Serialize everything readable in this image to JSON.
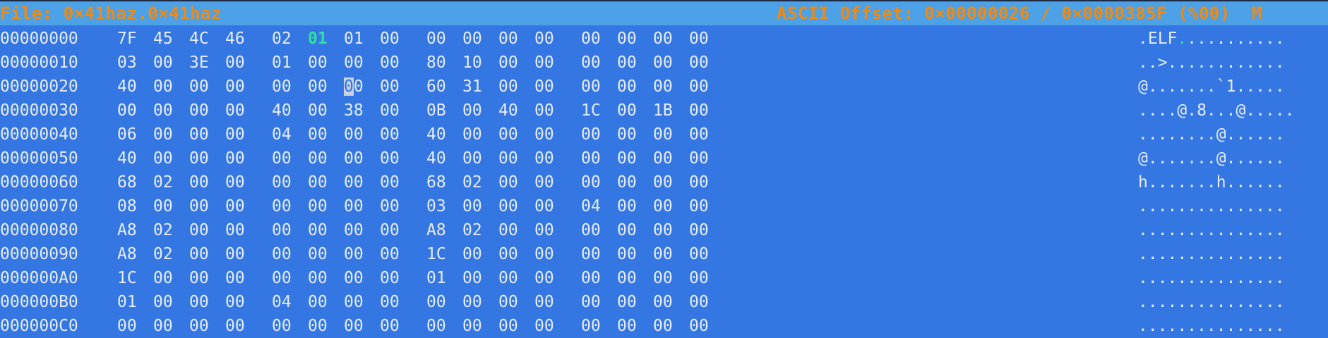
{
  "status": {
    "file_title": "File: 0×41haz.0×41haz",
    "offset_info": "ASCII Offset: 0×00000026 / 0×0000385F (%00)  M"
  },
  "colors": {
    "background": "#3477e3",
    "status_bar": "#4da1e6",
    "status_text": "#f08a10",
    "hex_text": "#e6ecf6",
    "highlight": "#2ee0a0"
  },
  "rows": [
    {
      "offset": "00000000",
      "bytes": [
        "7F",
        "45",
        "4C",
        "46",
        "02",
        "01",
        "01",
        "00",
        "00",
        "00",
        "00",
        "00",
        "00",
        "00",
        "00",
        "00"
      ],
      "ascii": ".ELF..........."
    },
    {
      "offset": "00000010",
      "bytes": [
        "03",
        "00",
        "3E",
        "00",
        "01",
        "00",
        "00",
        "00",
        "80",
        "10",
        "00",
        "00",
        "00",
        "00",
        "00",
        "00"
      ],
      "ascii": "..>............"
    },
    {
      "offset": "00000020",
      "bytes": [
        "40",
        "00",
        "00",
        "00",
        "00",
        "00",
        "00",
        "00",
        "60",
        "31",
        "00",
        "00",
        "00",
        "00",
        "00",
        "00"
      ],
      "ascii": "@.......`1....."
    },
    {
      "offset": "00000030",
      "bytes": [
        "00",
        "00",
        "00",
        "00",
        "40",
        "00",
        "38",
        "00",
        "0B",
        "00",
        "40",
        "00",
        "1C",
        "00",
        "1B",
        "00"
      ],
      "ascii": "....@.8...@....."
    },
    {
      "offset": "00000040",
      "bytes": [
        "06",
        "00",
        "00",
        "00",
        "04",
        "00",
        "00",
        "00",
        "40",
        "00",
        "00",
        "00",
        "00",
        "00",
        "00",
        "00"
      ],
      "ascii": "........@......"
    },
    {
      "offset": "00000050",
      "bytes": [
        "40",
        "00",
        "00",
        "00",
        "00",
        "00",
        "00",
        "00",
        "40",
        "00",
        "00",
        "00",
        "00",
        "00",
        "00",
        "00"
      ],
      "ascii": "@.......@......"
    },
    {
      "offset": "00000060",
      "bytes": [
        "68",
        "02",
        "00",
        "00",
        "00",
        "00",
        "00",
        "00",
        "68",
        "02",
        "00",
        "00",
        "00",
        "00",
        "00",
        "00"
      ],
      "ascii": "h.......h......"
    },
    {
      "offset": "00000070",
      "bytes": [
        "08",
        "00",
        "00",
        "00",
        "00",
        "00",
        "00",
        "00",
        "03",
        "00",
        "00",
        "00",
        "04",
        "00",
        "00",
        "00"
      ],
      "ascii": "..............."
    },
    {
      "offset": "00000080",
      "bytes": [
        "A8",
        "02",
        "00",
        "00",
        "00",
        "00",
        "00",
        "00",
        "A8",
        "02",
        "00",
        "00",
        "00",
        "00",
        "00",
        "00"
      ],
      "ascii": "..............."
    },
    {
      "offset": "00000090",
      "bytes": [
        "A8",
        "02",
        "00",
        "00",
        "00",
        "00",
        "00",
        "00",
        "1C",
        "00",
        "00",
        "00",
        "00",
        "00",
        "00",
        "00"
      ],
      "ascii": "..............."
    },
    {
      "offset": "000000A0",
      "bytes": [
        "1C",
        "00",
        "00",
        "00",
        "00",
        "00",
        "00",
        "00",
        "01",
        "00",
        "00",
        "00",
        "00",
        "00",
        "00",
        "00"
      ],
      "ascii": "..............."
    },
    {
      "offset": "000000B0",
      "bytes": [
        "01",
        "00",
        "00",
        "00",
        "04",
        "00",
        "00",
        "00",
        "00",
        "00",
        "00",
        "00",
        "00",
        "00",
        "00",
        "00"
      ],
      "ascii": "..............."
    },
    {
      "offset": "000000C0",
      "bytes": [
        "00",
        "00",
        "00",
        "00",
        "00",
        "00",
        "00",
        "00",
        "00",
        "00",
        "00",
        "00",
        "00",
        "00",
        "00",
        "00"
      ],
      "ascii": "..............."
    }
  ]
}
